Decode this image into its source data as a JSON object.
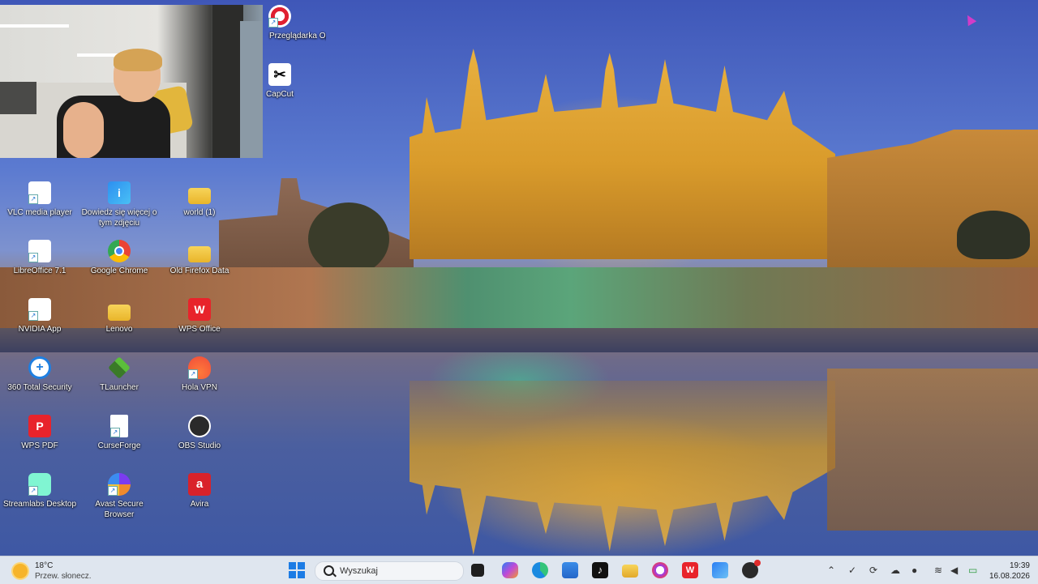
{
  "desktop_icons": [
    {
      "label": "Przeglądarka Opera",
      "icon": "opera-icon"
    },
    {
      "label": "CapCut",
      "icon": "capcut-icon"
    },
    {
      "label": "VLC media player",
      "icon": "vlc-icon"
    },
    {
      "label": "Dowiedz się więcej o tym zdjęciu",
      "icon": "info-icon"
    },
    {
      "label": "world (1)",
      "icon": "folder-icon"
    },
    {
      "label": "LibreOffice 7.1",
      "icon": "libreoffice-icon"
    },
    {
      "label": "Google Chrome",
      "icon": "chrome-icon"
    },
    {
      "label": "Old Firefox Data",
      "icon": "folder-icon"
    },
    {
      "label": "NVIDIA App",
      "icon": "nvidia-icon"
    },
    {
      "label": "Lenovo",
      "icon": "folder-icon"
    },
    {
      "label": "WPS Office",
      "icon": "wps-office-icon"
    },
    {
      "label": "360 Total Security",
      "icon": "security-icon"
    },
    {
      "label": "TLauncher",
      "icon": "tlauncher-icon"
    },
    {
      "label": "Hola VPN",
      "icon": "hola-icon"
    },
    {
      "label": "WPS PDF",
      "icon": "wps-pdf-icon"
    },
    {
      "label": "CurseForge",
      "icon": "file-icon"
    },
    {
      "label": "OBS Studio",
      "icon": "obs-icon"
    },
    {
      "label": "Streamlabs Desktop",
      "icon": "streamlabs-icon"
    },
    {
      "label": "Avast Secure Browser",
      "icon": "avast-icon"
    },
    {
      "label": "Avira",
      "icon": "avira-icon"
    }
  ],
  "taskbar": {
    "weather_temp": "18°C",
    "weather_desc": "Przew. słonecz.",
    "search_placeholder": "Wyszukaj",
    "time": "19:39",
    "date": "16.08.2026",
    "pinned": [
      "file-explorer-dark",
      "copilot",
      "edge",
      "microsoft-store",
      "tiktok",
      "file-explorer",
      "opera",
      "wps-office",
      "outlook",
      "obs-studio"
    ]
  }
}
